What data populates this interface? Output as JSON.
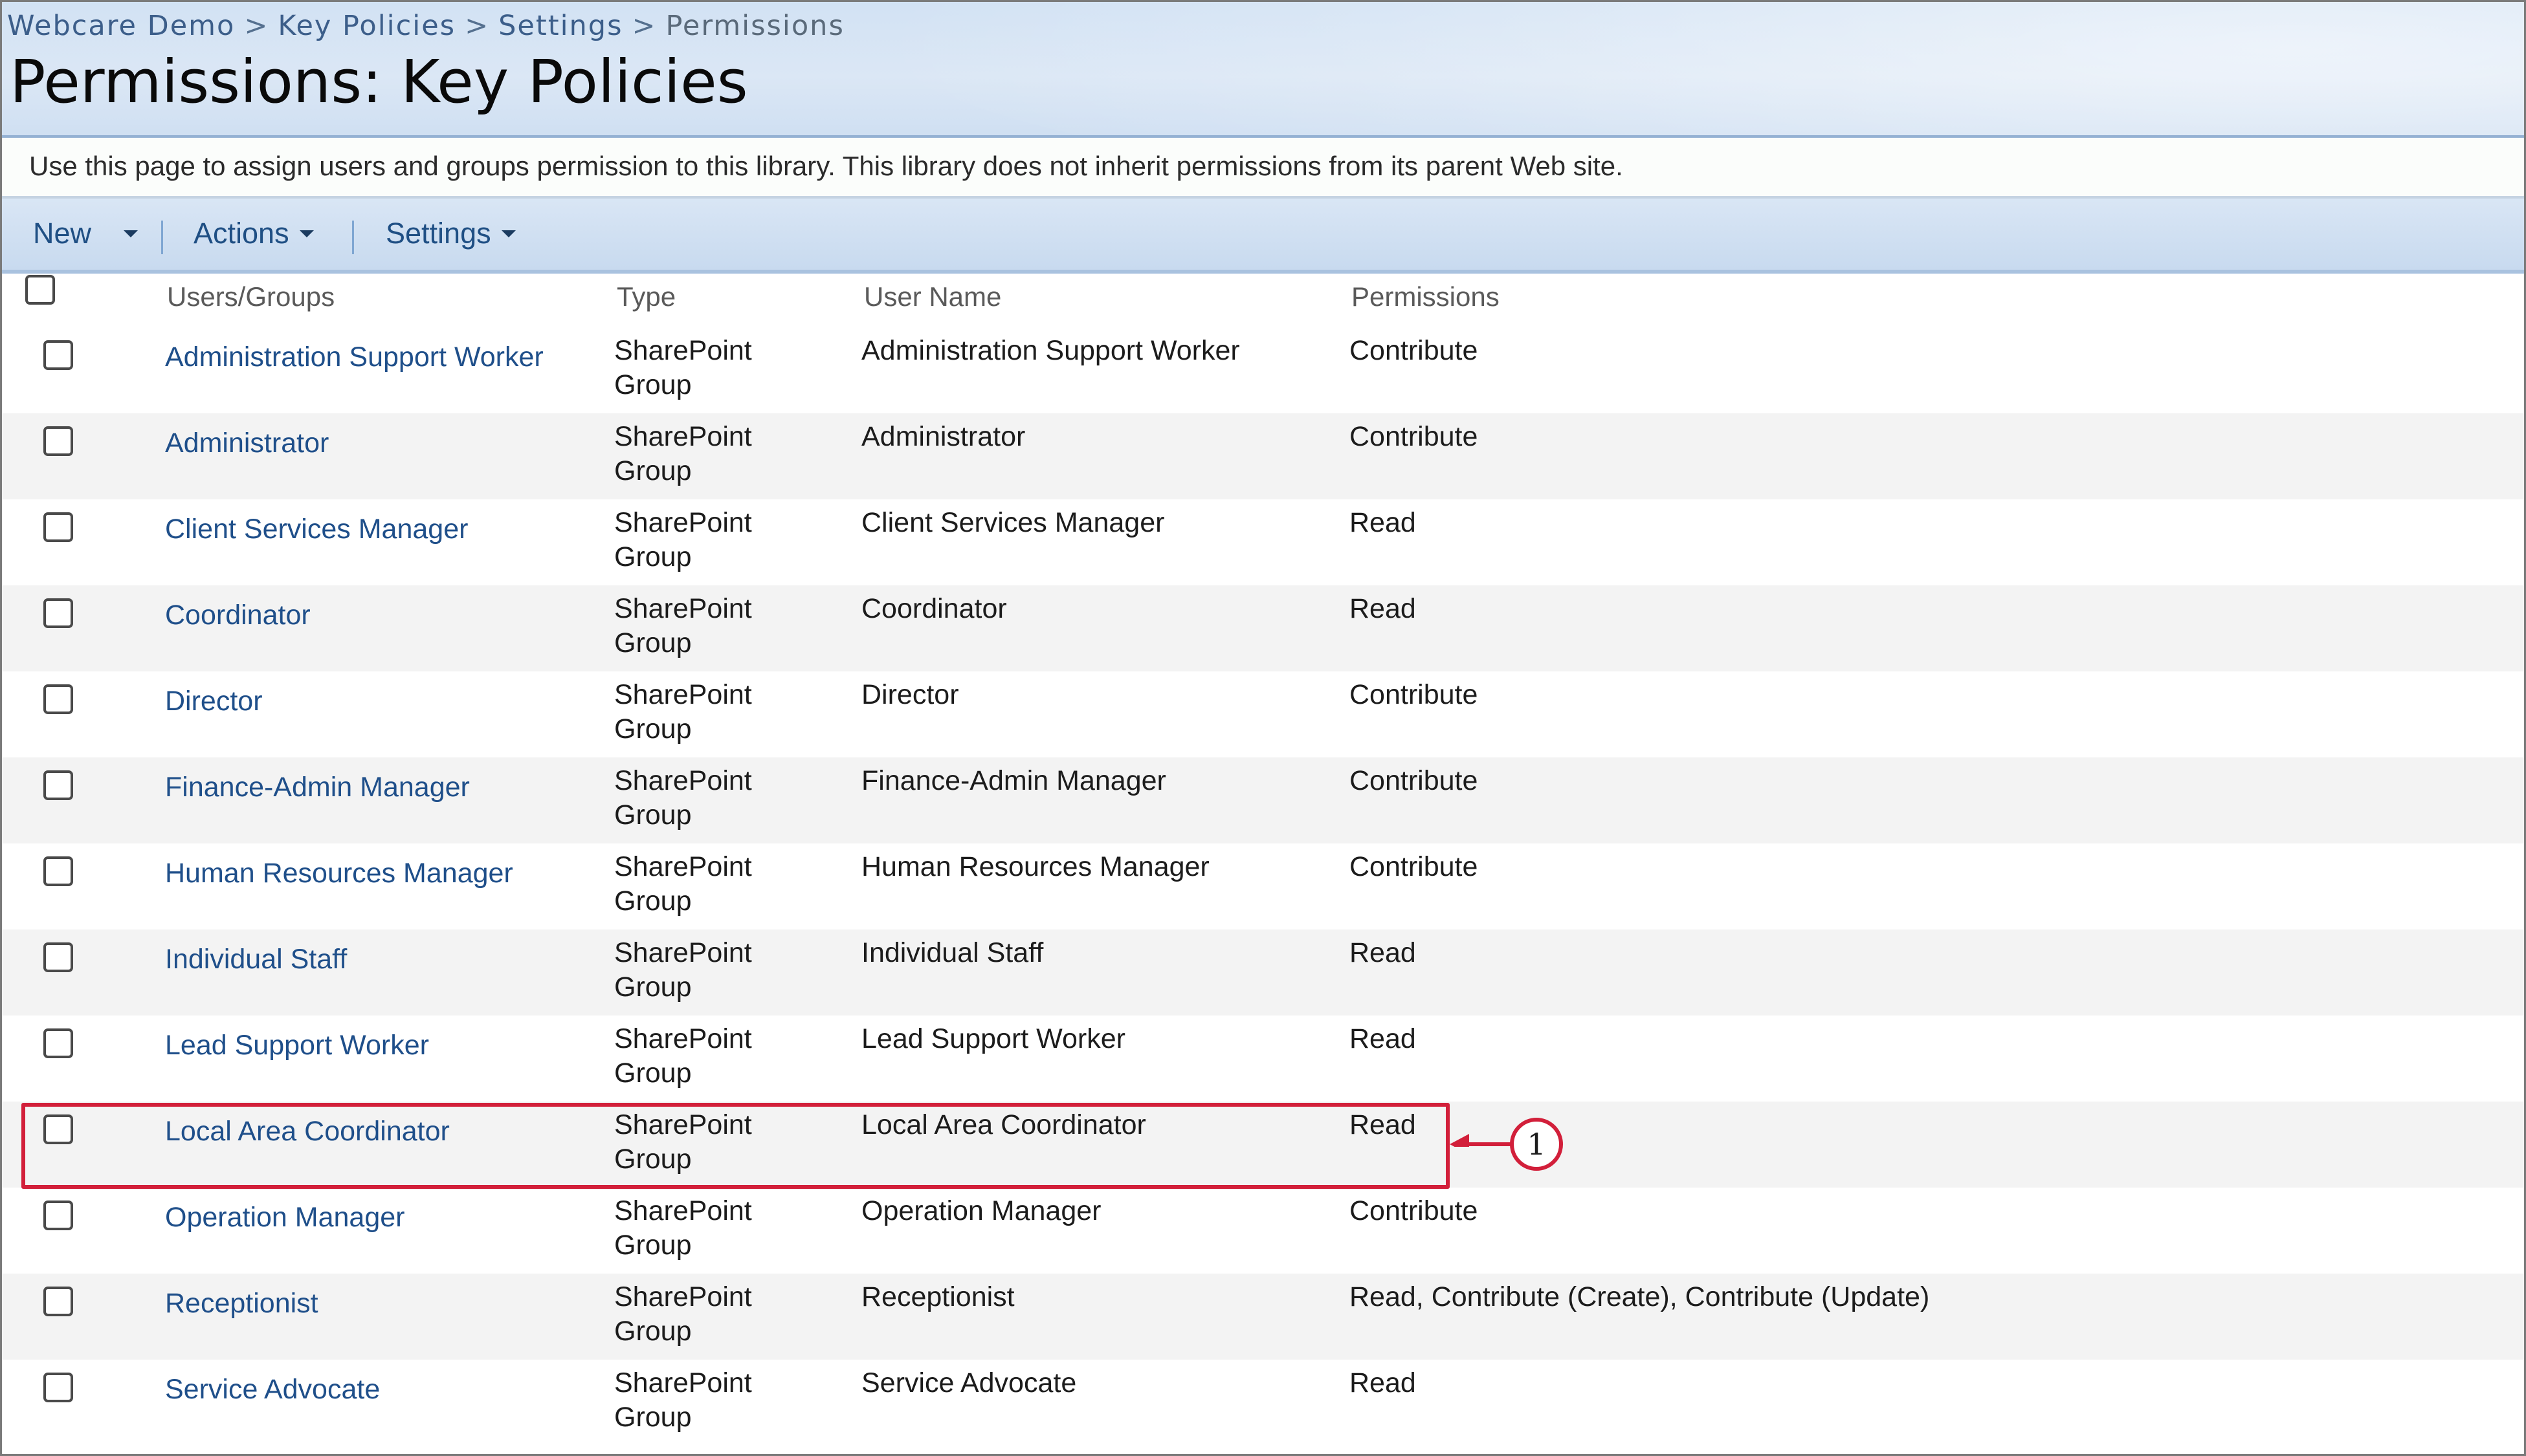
{
  "breadcrumb": {
    "items": [
      "Webcare Demo",
      "Key Policies",
      "Settings"
    ],
    "separator": ">",
    "current": "Permissions"
  },
  "page": {
    "title": "Permissions: Key Policies",
    "description": "Use this page to assign users and groups permission to this library. This library does not inherit permissions from its parent Web site."
  },
  "toolbar": {
    "new_label": "New",
    "actions_label": "Actions",
    "settings_label": "Settings"
  },
  "table": {
    "columns": {
      "users_groups": "Users/Groups",
      "type": "Type",
      "user_name": "User Name",
      "permissions": "Permissions"
    },
    "rows": [
      {
        "name": "Administration Support Worker",
        "type": "SharePoint Group",
        "user_name": "Administration Support Worker",
        "permissions": "Contribute"
      },
      {
        "name": "Administrator",
        "type": "SharePoint Group",
        "user_name": "Administrator",
        "permissions": "Contribute"
      },
      {
        "name": "Client Services Manager",
        "type": "SharePoint Group",
        "user_name": "Client Services Manager",
        "permissions": "Read"
      },
      {
        "name": "Coordinator",
        "type": "SharePoint Group",
        "user_name": "Coordinator",
        "permissions": "Read"
      },
      {
        "name": "Director",
        "type": "SharePoint Group",
        "user_name": "Director",
        "permissions": "Contribute"
      },
      {
        "name": "Finance-Admin Manager",
        "type": "SharePoint Group",
        "user_name": "Finance-Admin Manager",
        "permissions": "Contribute"
      },
      {
        "name": "Human Resources Manager",
        "type": "SharePoint Group",
        "user_name": "Human Resources Manager",
        "permissions": "Contribute"
      },
      {
        "name": "Individual Staff",
        "type": "SharePoint Group",
        "user_name": "Individual Staff",
        "permissions": "Read"
      },
      {
        "name": "Lead Support Worker",
        "type": "SharePoint Group",
        "user_name": "Lead Support Worker",
        "permissions": "Read"
      },
      {
        "name": "Local Area Coordinator",
        "type": "SharePoint Group",
        "user_name": "Local Area Coordinator",
        "permissions": "Read"
      },
      {
        "name": "Operation Manager",
        "type": "SharePoint Group",
        "user_name": "Operation Manager",
        "permissions": "Contribute"
      },
      {
        "name": "Receptionist",
        "type": "SharePoint Group",
        "user_name": "Receptionist",
        "permissions": "Read, Contribute (Create), Contribute (Update)"
      },
      {
        "name": "Service Advocate",
        "type": "SharePoint Group",
        "user_name": "Service Advocate",
        "permissions": "Read"
      }
    ]
  },
  "callout": {
    "number": "1",
    "highlighted_row": "Local Area Coordinator"
  },
  "colors": {
    "link": "#1f4f8a",
    "header_bg": "#d2e2f4",
    "toolbar_bg": "#c8daef",
    "callout": "#d21f3a",
    "alt_row": "#f3f3f3"
  }
}
